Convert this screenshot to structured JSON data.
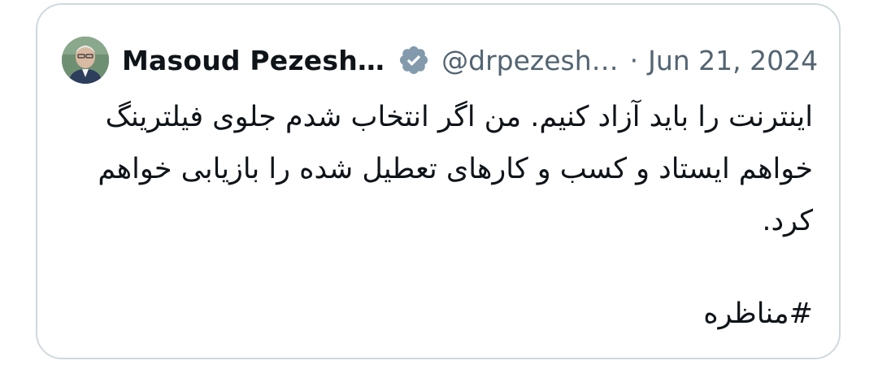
{
  "quoted_tweet": {
    "author_name": "Masoud Pezesh…",
    "verified_icon": "verified-badge-icon",
    "handle": "@drpezesh…",
    "separator": "·",
    "date": "Jun 21, 2024",
    "text_lines": [
      "اینترنت را باید آزاد کنیم. من اگر انتخاب شدم جلوی فیلترینگ",
      "خواهم ایستاد و کسب و کارهای تعطیل شده را بازیابی خواهم",
      "کرد."
    ],
    "hashtag": "#مناظره",
    "colors": {
      "text": "#0f1419",
      "secondary_text": "#536471",
      "border": "#cfd9de",
      "badge": "#829aab"
    }
  }
}
